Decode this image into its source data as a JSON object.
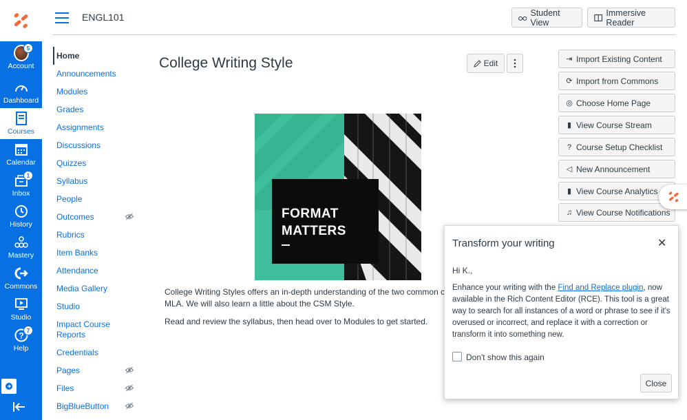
{
  "global_nav": {
    "items": [
      {
        "label": "Account",
        "icon": "avatar",
        "badge": "5"
      },
      {
        "label": "Dashboard",
        "icon": "dashboard-icon"
      },
      {
        "label": "Courses",
        "icon": "courses-icon"
      },
      {
        "label": "Calendar",
        "icon": "calendar-icon"
      },
      {
        "label": "Inbox",
        "icon": "inbox-icon",
        "badge": "1"
      },
      {
        "label": "History",
        "icon": "history-icon"
      },
      {
        "label": "Mastery",
        "icon": "mastery-icon"
      },
      {
        "label": "Commons",
        "icon": "commons-icon"
      },
      {
        "label": "Studio",
        "icon": "studio-icon"
      },
      {
        "label": "Help",
        "icon": "help-icon",
        "badge": "7"
      }
    ],
    "active": "Courses",
    "accent": "#0770e3"
  },
  "header": {
    "breadcrumb": "ENGL101",
    "student_view": "Student View",
    "immersive_reader": "Immersive Reader"
  },
  "course_nav": {
    "items": [
      {
        "label": "Home",
        "hidden": false
      },
      {
        "label": "Announcements",
        "hidden": false
      },
      {
        "label": "Modules",
        "hidden": false
      },
      {
        "label": "Grades",
        "hidden": false
      },
      {
        "label": "Assignments",
        "hidden": false
      },
      {
        "label": "Discussions",
        "hidden": false
      },
      {
        "label": "Quizzes",
        "hidden": false
      },
      {
        "label": "Syllabus",
        "hidden": false
      },
      {
        "label": "People",
        "hidden": false
      },
      {
        "label": "Outcomes",
        "hidden": true
      },
      {
        "label": "Rubrics",
        "hidden": false
      },
      {
        "label": "Item Banks",
        "hidden": false
      },
      {
        "label": "Attendance",
        "hidden": false
      },
      {
        "label": "Media Gallery",
        "hidden": false
      },
      {
        "label": "Studio",
        "hidden": false
      },
      {
        "label": "Impact Course Reports",
        "hidden": false
      },
      {
        "label": "Credentials",
        "hidden": false
      },
      {
        "label": "Pages",
        "hidden": true
      },
      {
        "label": "Files",
        "hidden": true
      },
      {
        "label": "BigBlueButton",
        "hidden": true
      }
    ]
  },
  "main": {
    "title": "College Writing Style",
    "edit_label": "Edit",
    "hero": {
      "line1": "FORMAT",
      "line2": "MATTERS"
    },
    "paragraph1_line1": "College Writing Styles offers an in-depth understanding of the two common colleg",
    "paragraph1_line2": "MLA. We will also learn a little about the CSM Style.",
    "paragraph2": "Read and review the syllabus, then head over to Modules to get started."
  },
  "sidebar": {
    "buttons": [
      {
        "label": "Import Existing Content",
        "icon": "import-icon"
      },
      {
        "label": "Import from Commons",
        "icon": "commons-icon"
      },
      {
        "label": "Choose Home Page",
        "icon": "target-icon"
      },
      {
        "label": "View Course Stream",
        "icon": "bar-chart-icon"
      },
      {
        "label": "Course Setup Checklist",
        "icon": "question-icon"
      },
      {
        "label": "New Announcement",
        "icon": "megaphone-icon"
      },
      {
        "label": "View Course Analytics",
        "icon": "bar-chart-icon"
      },
      {
        "label": "View Course Notifications",
        "icon": "bell-icon"
      }
    ]
  },
  "modal": {
    "title": "Transform your writing",
    "greeting": "Hi K.,",
    "body_before": "Enhance your writing with the ",
    "body_link": "Find and Replace plugin",
    "body_after": ", now available in the Rich Content Editor (RCE). This tool is a great way to search for all instances of a word or phrase to see if it's overused or incorrect, and replace it with a correction or transform it into something new.",
    "checkbox_label": "Don't show this again",
    "close_label": "Close"
  }
}
